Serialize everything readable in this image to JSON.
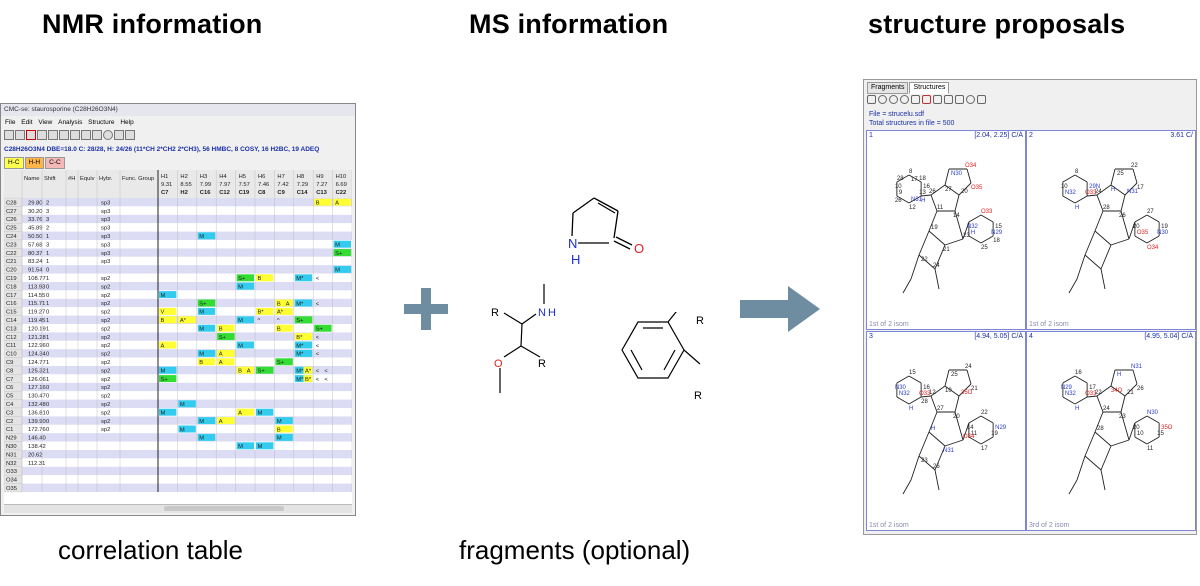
{
  "headers": {
    "nmr": "NMR information",
    "ms": "MS information",
    "structures": "structure proposals"
  },
  "captions": {
    "nmr": "correlation table",
    "ms": "fragments (optional)"
  },
  "nmr_window": {
    "title": "CMC-se: staurosporine (C28H26O3N4)",
    "menu": [
      "File",
      "Edit",
      "View",
      "Analysis",
      "Structure",
      "Help"
    ],
    "formula_line": "C28H26O3N4 DBE=18.0 C: 28/28, H: 24/26 (11*CH 2*CH2 2*CH3), 56 HMBC, 8 COSY, 16 H2BC, 19 ADEQ",
    "tabs": [
      "H-C",
      "H-H",
      "C-C"
    ],
    "columns": [
      "Name",
      "Shift",
      "#H",
      "Equiv",
      "Hybr.",
      "Func. Group"
    ],
    "h_columns": [
      {
        "name": "H1",
        "shift": "9.31",
        "atom": "C7"
      },
      {
        "name": "H2",
        "shift": "8.55",
        "atom": "H2"
      },
      {
        "name": "H3",
        "shift": "7.99",
        "atom": "C16"
      },
      {
        "name": "H4",
        "shift": "7.97",
        "atom": "C12"
      },
      {
        "name": "H5",
        "shift": "7.57",
        "atom": "C19"
      },
      {
        "name": "H6",
        "shift": "7.46",
        "atom": "C8"
      },
      {
        "name": "H7",
        "shift": "7.42",
        "atom": "C9"
      },
      {
        "name": "H8",
        "shift": "7.29",
        "atom": "C14"
      },
      {
        "name": "H9",
        "shift": "7.27",
        "atom": "C13"
      },
      {
        "name": "H10",
        "shift": "6.69",
        "atom": "C22"
      }
    ],
    "rows": [
      {
        "name": "C28",
        "shift": "29.80",
        "nh": "2",
        "hybr": "sp3"
      },
      {
        "name": "C27",
        "shift": "30.20",
        "nh": "3",
        "hybr": "sp3"
      },
      {
        "name": "C26",
        "shift": "33.76",
        "nh": "3",
        "hybr": "sp3"
      },
      {
        "name": "C25",
        "shift": "45.89",
        "nh": "2",
        "hybr": "sp3"
      },
      {
        "name": "C24",
        "shift": "50.50",
        "nh": "1",
        "hybr": "sp3"
      },
      {
        "name": "C23",
        "shift": "57.68",
        "nh": "3",
        "hybr": "sp3"
      },
      {
        "name": "C22",
        "shift": "80.37",
        "nh": "1",
        "hybr": "sp3"
      },
      {
        "name": "C21",
        "shift": "83.24",
        "nh": "1",
        "hybr": "sp3"
      },
      {
        "name": "C20",
        "shift": "91.54",
        "nh": "0",
        "hybr": ""
      },
      {
        "name": "C19",
        "shift": "108.77",
        "nh": "1",
        "hybr": "sp2"
      },
      {
        "name": "C18",
        "shift": "113.93",
        "nh": "0",
        "hybr": "sp2"
      },
      {
        "name": "C17",
        "shift": "114.55",
        "nh": "0",
        "hybr": "sp2"
      },
      {
        "name": "C16",
        "shift": "115.71",
        "nh": "1",
        "hybr": "sp2"
      },
      {
        "name": "C15",
        "shift": "119.27",
        "nh": "0",
        "hybr": "sp2"
      },
      {
        "name": "C14",
        "shift": "119.45",
        "nh": "1",
        "hybr": "sp2"
      },
      {
        "name": "C13",
        "shift": "120.19",
        "nh": "1",
        "hybr": "sp2"
      },
      {
        "name": "C12",
        "shift": "121.28",
        "nh": "1",
        "hybr": "sp2"
      },
      {
        "name": "C11",
        "shift": "122.96",
        "nh": "0",
        "hybr": "sp2"
      },
      {
        "name": "C10",
        "shift": "124.34",
        "nh": "0",
        "hybr": "sp2"
      },
      {
        "name": "C9",
        "shift": "124.77",
        "nh": "1",
        "hybr": "sp2"
      },
      {
        "name": "C8",
        "shift": "125.32",
        "nh": "1",
        "hybr": "sp2"
      },
      {
        "name": "C7",
        "shift": "126.06",
        "nh": "1",
        "hybr": "sp2"
      },
      {
        "name": "C6",
        "shift": "127.16",
        "nh": "0",
        "hybr": "sp2"
      },
      {
        "name": "C5",
        "shift": "130.47",
        "nh": "0",
        "hybr": "sp2"
      },
      {
        "name": "C4",
        "shift": "132.48",
        "nh": "0",
        "hybr": "sp2"
      },
      {
        "name": "C3",
        "shift": "136.81",
        "nh": "0",
        "hybr": "sp2"
      },
      {
        "name": "C2",
        "shift": "139.90",
        "nh": "0",
        "hybr": "sp2"
      },
      {
        "name": "C1",
        "shift": "172.76",
        "nh": "0",
        "hybr": "sp2"
      },
      {
        "name": "N29",
        "shift": "146.40",
        "nh": "",
        "hybr": ""
      },
      {
        "name": "N30",
        "shift": "138.42",
        "nh": "",
        "hybr": ""
      },
      {
        "name": "N31",
        "shift": "20.62",
        "nh": "",
        "hybr": ""
      },
      {
        "name": "N32",
        "shift": "112.31",
        "nh": "",
        "hybr": ""
      },
      {
        "name": "O33",
        "shift": "",
        "nh": "",
        "hybr": ""
      },
      {
        "name": "O34",
        "shift": "",
        "nh": "",
        "hybr": ""
      },
      {
        "name": "O35",
        "shift": "",
        "nh": "",
        "hybr": ""
      }
    ],
    "cells": [
      [
        0,
        9,
        "B",
        "yellow"
      ],
      [
        0,
        10,
        "A",
        "yellow"
      ],
      [
        4,
        3,
        "M",
        "cyan"
      ],
      [
        5,
        10,
        "M",
        "cyan"
      ],
      [
        6,
        10,
        "S+",
        "green"
      ],
      [
        8,
        10,
        "M",
        "cyan"
      ],
      [
        9,
        5,
        "S+",
        "green"
      ],
      [
        9,
        6,
        "B",
        "yellow"
      ],
      [
        9,
        8,
        "M*",
        "cyan"
      ],
      [
        9,
        9,
        "<",
        "white"
      ],
      [
        10,
        5,
        "M",
        "cyan"
      ],
      [
        11,
        1,
        "M",
        "cyan"
      ],
      [
        12,
        3,
        "S+",
        "green"
      ],
      [
        12,
        7,
        "B",
        "yellow"
      ],
      [
        12,
        7.55,
        "A",
        "yellow"
      ],
      [
        12,
        8,
        "M*",
        "cyan"
      ],
      [
        12,
        9,
        "<",
        "white"
      ],
      [
        13,
        1,
        "V",
        "yellow"
      ],
      [
        13,
        3,
        "M",
        "cyan"
      ],
      [
        13,
        6,
        "B*",
        "yellow"
      ],
      [
        13,
        7,
        "A*",
        "yellow"
      ],
      [
        14,
        1,
        "B",
        "yellow"
      ],
      [
        14,
        2,
        "A*",
        "yellow"
      ],
      [
        14,
        5,
        "M",
        "cyan"
      ],
      [
        14,
        6,
        "^",
        "white"
      ],
      [
        14,
        7,
        "^",
        "white"
      ],
      [
        14,
        8,
        "S+",
        "green"
      ],
      [
        15,
        3,
        "M",
        "cyan"
      ],
      [
        15,
        4,
        "B",
        "yellow"
      ],
      [
        15,
        7,
        "B",
        "yellow"
      ],
      [
        15,
        9,
        "S+",
        "green"
      ],
      [
        16,
        4,
        "S+",
        "green"
      ],
      [
        16,
        8,
        "B*",
        "yellow"
      ],
      [
        16,
        9,
        "<",
        "white"
      ],
      [
        17,
        1,
        "A",
        "yellow"
      ],
      [
        17,
        5,
        "M",
        "cyan"
      ],
      [
        17,
        8,
        "M*",
        "cyan"
      ],
      [
        17,
        9,
        "<",
        "white"
      ],
      [
        18,
        3,
        "M",
        "cyan"
      ],
      [
        18,
        4,
        "A",
        "yellow"
      ],
      [
        18,
        8,
        "M*",
        "cyan"
      ],
      [
        18,
        9,
        "<",
        "white"
      ],
      [
        19,
        3,
        "B",
        "yellow"
      ],
      [
        19,
        4,
        "A",
        "yellow"
      ],
      [
        19,
        7,
        "S+",
        "green"
      ],
      [
        20,
        1,
        "M",
        "cyan"
      ],
      [
        20,
        5,
        "B",
        "yellow"
      ],
      [
        20,
        5.5,
        "A",
        "yellow"
      ],
      [
        20,
        6,
        "S+",
        "green"
      ],
      [
        20,
        8,
        "M*",
        "cyan"
      ],
      [
        20,
        8.5,
        "A*",
        "yellow"
      ],
      [
        20,
        9,
        "<",
        "white"
      ],
      [
        20,
        9.5,
        "<",
        "white"
      ],
      [
        21,
        1,
        "S+",
        "green"
      ],
      [
        21,
        8,
        "M*",
        "cyan"
      ],
      [
        21,
        8.5,
        "B*",
        "yellow"
      ],
      [
        21,
        9,
        "<",
        "white"
      ],
      [
        21,
        9.5,
        "<",
        "white"
      ],
      [
        24,
        2,
        "M",
        "cyan"
      ],
      [
        25,
        1,
        "M",
        "cyan"
      ],
      [
        25,
        5,
        "A",
        "yellow"
      ],
      [
        25,
        6,
        "M",
        "cyan"
      ],
      [
        26,
        3,
        "M",
        "cyan"
      ],
      [
        26,
        4,
        "A",
        "yellow"
      ],
      [
        26,
        7,
        "M",
        "cyan"
      ],
      [
        27,
        2,
        "M",
        "cyan"
      ],
      [
        27,
        7,
        "B",
        "yellow"
      ],
      [
        28,
        3,
        "M",
        "cyan"
      ],
      [
        28,
        7,
        "M",
        "cyan"
      ],
      [
        29,
        5,
        "M",
        "cyan"
      ],
      [
        29,
        6,
        "M",
        "cyan"
      ]
    ]
  },
  "fragments": {
    "plus": "+",
    "pyrrolinone": {
      "N": "N",
      "H": "H",
      "O": "O"
    },
    "aminoether": {
      "R1": "R",
      "N": "N",
      "H": "H",
      "O": "O",
      "R2": "R"
    },
    "benzene": {
      "R1": "R",
      "R2": "R"
    }
  },
  "struct_window": {
    "tabs": [
      "Fragments",
      "Structures"
    ],
    "file_line": "File = strucelu.sdf",
    "total_line": "Total structures in file = 500",
    "panels": [
      {
        "index": "1",
        "range": "[2.04, 2.25] C/Á",
        "footer": "1st of 2 isom"
      },
      {
        "index": "2",
        "range": "3.61 C/",
        "footer": "1st of 2 isom"
      },
      {
        "index": "3",
        "range": "[4.94, 5.05] C/Á",
        "footer": "1st of 2 isom"
      },
      {
        "index": "4",
        "range": "[4.95, 5.04] C/Á",
        "footer": "3rd of 2 isom"
      }
    ],
    "atom_labels": {
      "p1": [
        "13",
        "12",
        "9",
        "10",
        "8",
        "16",
        "N29",
        "25",
        "H",
        "N32",
        "O33",
        "15",
        "26",
        "27",
        "20",
        "14",
        "11",
        "N30",
        "O34",
        "O35",
        "19",
        "21",
        "23",
        "22",
        "24",
        "H",
        "N31",
        "26",
        "28",
        "17",
        "18",
        "18"
      ],
      "p2": [
        "O33",
        "H",
        "N32",
        "10",
        "8",
        "29N",
        "N30",
        "O34",
        "O35",
        "20",
        "27",
        "19",
        "24",
        "H",
        "N31",
        "26",
        "28",
        "25",
        "22",
        "17"
      ],
      "p3": [
        "O33",
        "H",
        "N32",
        "N30",
        "15",
        "16",
        "19",
        "17",
        "11",
        "14",
        "22",
        "N29",
        "12",
        "10",
        "35O",
        "20",
        "27",
        "25",
        "24",
        "21",
        "H",
        "N31",
        "O34",
        "23",
        "26",
        "28"
      ],
      "p4": [
        "O33",
        "H",
        "N32",
        "N29",
        "16",
        "17",
        "15",
        "11",
        "10",
        "20",
        "N30",
        "35O",
        "22",
        "34O",
        "21",
        "23",
        "24",
        "H",
        "N31",
        "26",
        "28"
      ]
    }
  }
}
